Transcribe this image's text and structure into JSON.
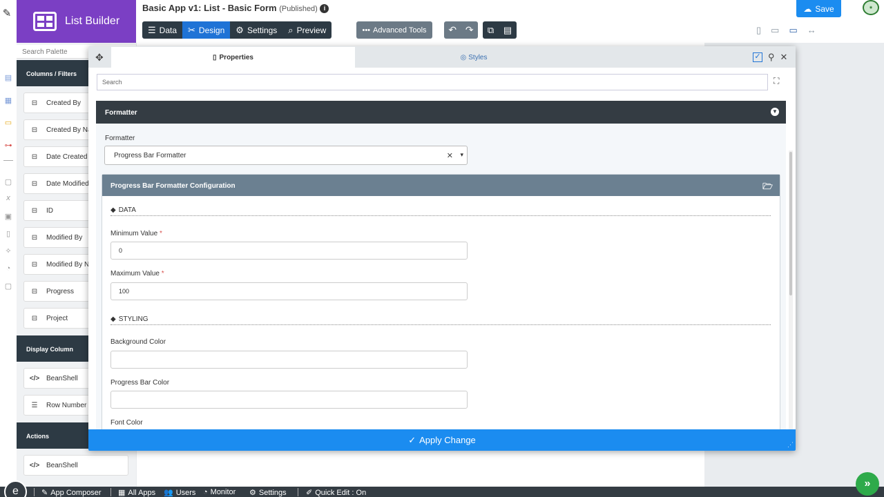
{
  "header": {
    "brand": "List Builder",
    "title": "Basic App v1: List - Basic Form",
    "status": "(Published)",
    "tabs": [
      {
        "label": "Data",
        "icon": "list-icon"
      },
      {
        "label": "Design",
        "icon": "tools-icon"
      },
      {
        "label": "Settings",
        "icon": "gear-icon"
      },
      {
        "label": "Preview",
        "icon": "preview-icon"
      }
    ],
    "advanced_tools": "Advanced Tools",
    "save": "Save"
  },
  "palette": {
    "search_placeholder": "Search Palette",
    "sections": [
      {
        "title": "Columns / Filters",
        "items": [
          "Created By",
          "Created By Name",
          "Date Created",
          "Date Modified",
          "ID",
          "Modified By",
          "Modified By Name",
          "Progress",
          "Project"
        ]
      },
      {
        "title": "Display Column",
        "items": [
          "BeanShell",
          "Row Number"
        ]
      },
      {
        "title": "Actions",
        "items": [
          "BeanShell"
        ]
      }
    ]
  },
  "dialog": {
    "tab_properties": "Properties",
    "tab_styles": "Styles",
    "search_placeholder": "Search",
    "formatter_header": "Formatter",
    "formatter_label": "Formatter",
    "formatter_value": "Progress Bar Formatter",
    "config_header": "Progress Bar Formatter Configuration",
    "section_data": "DATA",
    "section_styling": "STYLING",
    "fields": {
      "min_label": "Minimum Value",
      "min_value": "0",
      "max_label": "Maximum Value",
      "max_value": "100",
      "bg_label": "Background Color",
      "bg_value": "",
      "bar_label": "Progress Bar Color",
      "bar_value": "",
      "font_label": "Font Color"
    },
    "required_mark": "*",
    "apply": "Apply Change"
  },
  "footer": {
    "items": [
      "App Composer",
      "All Apps",
      "Users",
      "Monitor",
      "Settings",
      "Quick Edit : On"
    ]
  },
  "colors": {
    "brand": "#7b3fc4",
    "accent": "#1b8cf0",
    "dark": "#343c43"
  }
}
